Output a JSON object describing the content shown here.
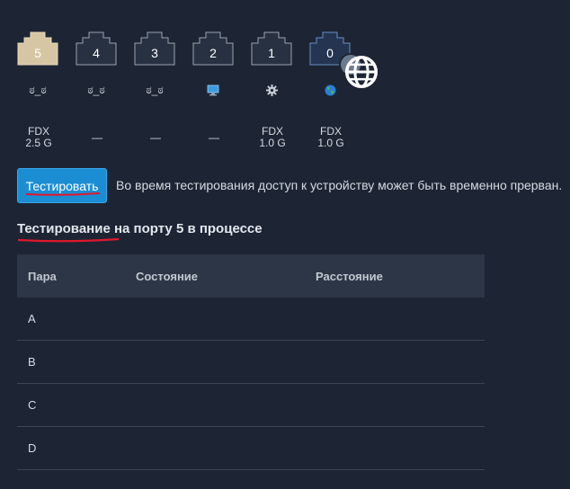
{
  "ports": [
    {
      "number": "5",
      "status_icon": "cable-disconnected-icon",
      "status_glyph": "ಠ_ಠ",
      "duplex": "FDX",
      "speed": "2.5 G",
      "active": true
    },
    {
      "number": "4",
      "status_icon": "cable-disconnected-icon",
      "status_glyph": "ಠ_ಠ",
      "duplex": "",
      "speed": "—",
      "active": false
    },
    {
      "number": "3",
      "status_icon": "cable-disconnected-icon",
      "status_glyph": "ಠ_ಠ",
      "duplex": "",
      "speed": "—",
      "active": false
    },
    {
      "number": "2",
      "status_icon": "computer-icon",
      "status_glyph": "",
      "duplex": "",
      "speed": "—",
      "active": false
    },
    {
      "number": "1",
      "status_icon": "gear-icon",
      "status_glyph": "",
      "duplex": "FDX",
      "speed": "1.0 G",
      "active": false
    },
    {
      "number": "0",
      "status_icon": "globe-icon",
      "status_glyph": "",
      "duplex": "FDX",
      "speed": "1.0 G",
      "active": false,
      "wan": true
    }
  ],
  "test": {
    "button_label": "Тестировать",
    "note": "Во время тестирования доступ к устройству может быть временно прерван."
  },
  "status_title": "Тестирование на порту 5 в процессе",
  "table": {
    "headers": [
      "Пара",
      "Состояние",
      "Расстояние"
    ],
    "rows": [
      [
        "A",
        "",
        ""
      ],
      [
        "B",
        "",
        ""
      ],
      [
        "C",
        "",
        ""
      ],
      [
        "D",
        "",
        ""
      ]
    ]
  },
  "colors": {
    "background": "#1d2534",
    "accent": "#1b8ed3",
    "active_port": "#d6c6a4",
    "underline": "#e0182d"
  }
}
